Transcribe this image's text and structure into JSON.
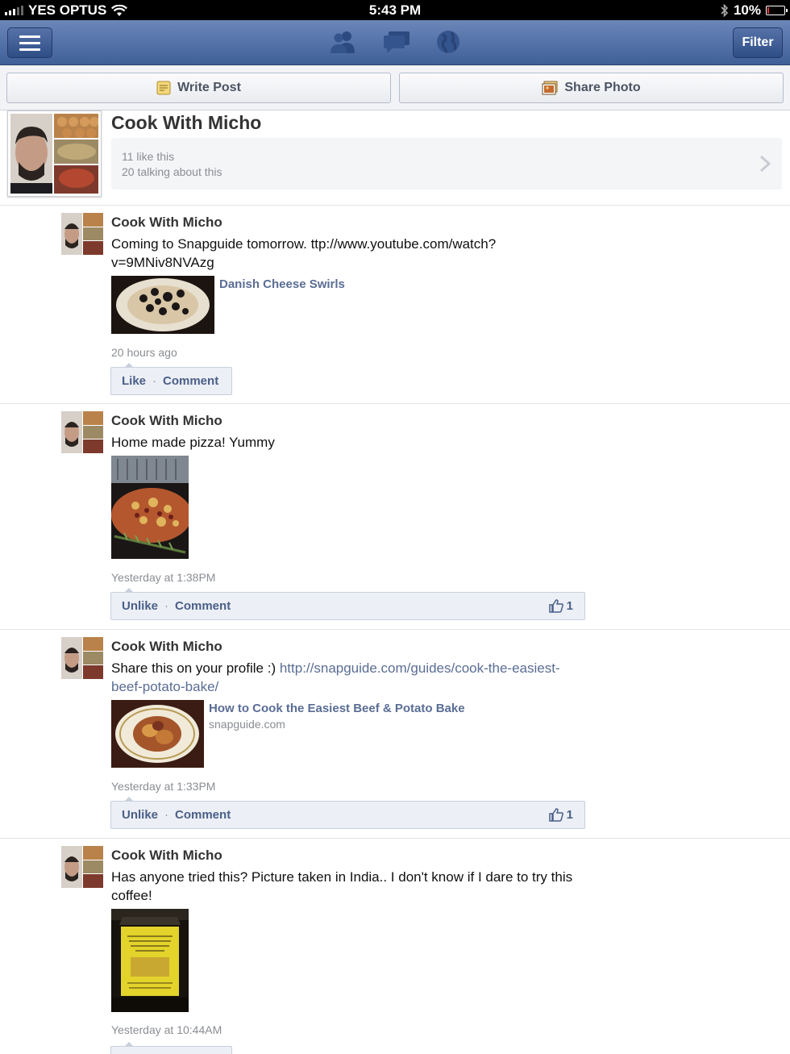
{
  "status_bar": {
    "carrier": "YES OPTUS",
    "time": "5:43 PM",
    "battery": "10%",
    "battery_level": 0.1
  },
  "navbar": {
    "filter_label": "Filter",
    "icons": [
      "menu-icon",
      "friends-icon",
      "messages-icon",
      "globe-icon"
    ]
  },
  "actions": {
    "write_post": "Write Post",
    "share_photo": "Share Photo"
  },
  "page": {
    "name": "Cook With Micho",
    "likes": "11 like this",
    "talking": "20 talking about this"
  },
  "posts": [
    {
      "author": "Cook With Micho",
      "message": "Coming to Snapguide tomorrow. ttp://www.youtube.com/watch?v=9MNiv8NVAzg",
      "link_title": "Danish Cheese Swirls",
      "time": "20 hours ago",
      "like_label": "Like",
      "comment_label": "Comment"
    },
    {
      "author": "Cook With Micho",
      "message": "Home made pizza! Yummy",
      "time": "Yesterday at 1:38PM",
      "like_label": "Unlike",
      "comment_label": "Comment",
      "like_count": "1"
    },
    {
      "author": "Cook With Micho",
      "message": "Share this on your profile :)",
      "message_link": "http://snapguide.com/guides/cook-the-easiest-beef-potato-bake/",
      "link_title": "How to Cook the Easiest Beef & Potato Bake",
      "link_domain": "snapguide.com",
      "time": "Yesterday at 1:33PM",
      "like_label": "Unlike",
      "comment_label": "Comment",
      "like_count": "1"
    },
    {
      "author": "Cook With Micho",
      "message": "Has anyone tried this? Picture taken in India.. I don't know if I dare to try this coffee!",
      "time": "Yesterday at 10:44AM"
    }
  ],
  "colors": {
    "nav_top": "#6b87b9",
    "nav_bottom": "#3f5f98",
    "link": "#5a6d94",
    "ufi_bg": "#eceff5"
  }
}
